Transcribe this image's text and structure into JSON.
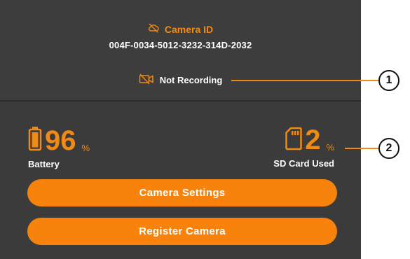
{
  "header": {
    "camera_id_label": "Camera ID",
    "camera_id_value": "004F-0034-5012-3232-314D-2032",
    "recording_status": "Not Recording"
  },
  "stats": {
    "battery": {
      "value": "96",
      "unit": "%",
      "label": "Battery",
      "icon": "battery-icon"
    },
    "sd_card": {
      "value": "2",
      "unit": "%",
      "label": "SD Card Used",
      "icon": "sd-card-icon"
    }
  },
  "buttons": {
    "camera_settings": "Camera Settings",
    "register_camera": "Register Camera"
  },
  "callouts": [
    "1",
    "2"
  ],
  "colors": {
    "accent": "#f08a14",
    "button": "#f7820c",
    "panel": "#3b3b3b",
    "text": "#ffffff"
  }
}
